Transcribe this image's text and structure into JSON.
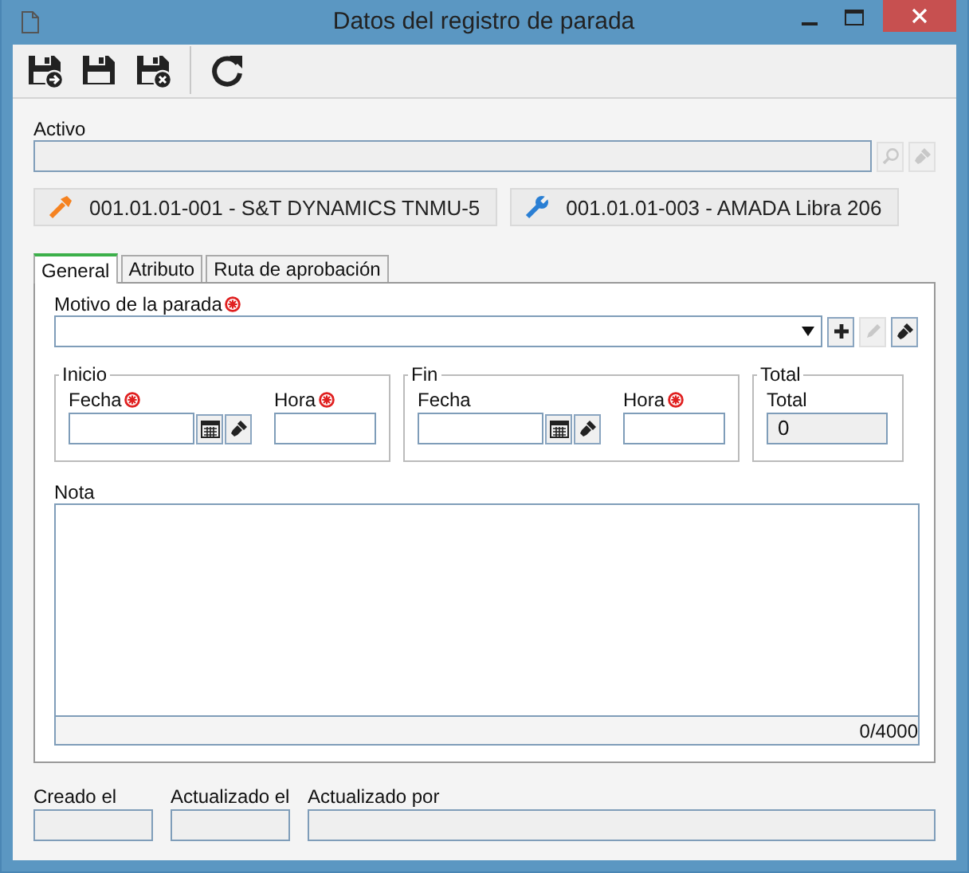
{
  "window": {
    "title": "Datos del registro de parada"
  },
  "toolbar": [
    {
      "kind": "save-new",
      "disabled": false
    },
    {
      "kind": "save",
      "disabled": false
    },
    {
      "kind": "save-close",
      "disabled": false
    },
    {
      "kind": "refresh",
      "disabled": false
    }
  ],
  "activo": {
    "label": "Activo",
    "actions": [
      {
        "kind": "search",
        "disabled": true
      },
      {
        "kind": "clear",
        "disabled": true
      }
    ]
  },
  "assets": [
    {
      "kind": "tool",
      "label": "001.01.01-001 - S&T DYNAMICS TNMU-5"
    },
    {
      "kind": "wrench",
      "label": "001.01.01-003 - AMADA Libra 206"
    }
  ],
  "tabs": [
    {
      "label": "General",
      "selected": true
    },
    {
      "label": "Atributo",
      "selected": false
    },
    {
      "label": "Ruta de aprobación",
      "selected": false
    }
  ],
  "motivo": {
    "label": "Motivo de la parada",
    "required": true,
    "actions": [
      {
        "kind": "add",
        "disabled": false
      },
      {
        "kind": "edit",
        "disabled": true
      },
      {
        "kind": "clear",
        "disabled": false
      }
    ]
  },
  "groups": [
    {
      "kind": "datetime",
      "title": "Inicio",
      "fecha": {
        "label": "Fecha",
        "required": true
      },
      "hora": {
        "label": "Hora",
        "required": true
      }
    },
    {
      "kind": "datetime",
      "title": "Fin",
      "fecha": {
        "label": "Fecha",
        "required": false
      },
      "hora": {
        "label": "Hora",
        "required": true
      }
    },
    {
      "kind": "total",
      "title": "Total",
      "field": {
        "label": "Total",
        "value": "0"
      }
    }
  ],
  "nota": {
    "label": "Nota",
    "counter": "0/4000"
  },
  "footer": [
    {
      "label": "Creado el"
    },
    {
      "label": "Actualizado el"
    },
    {
      "label": "Actualizado por"
    }
  ]
}
